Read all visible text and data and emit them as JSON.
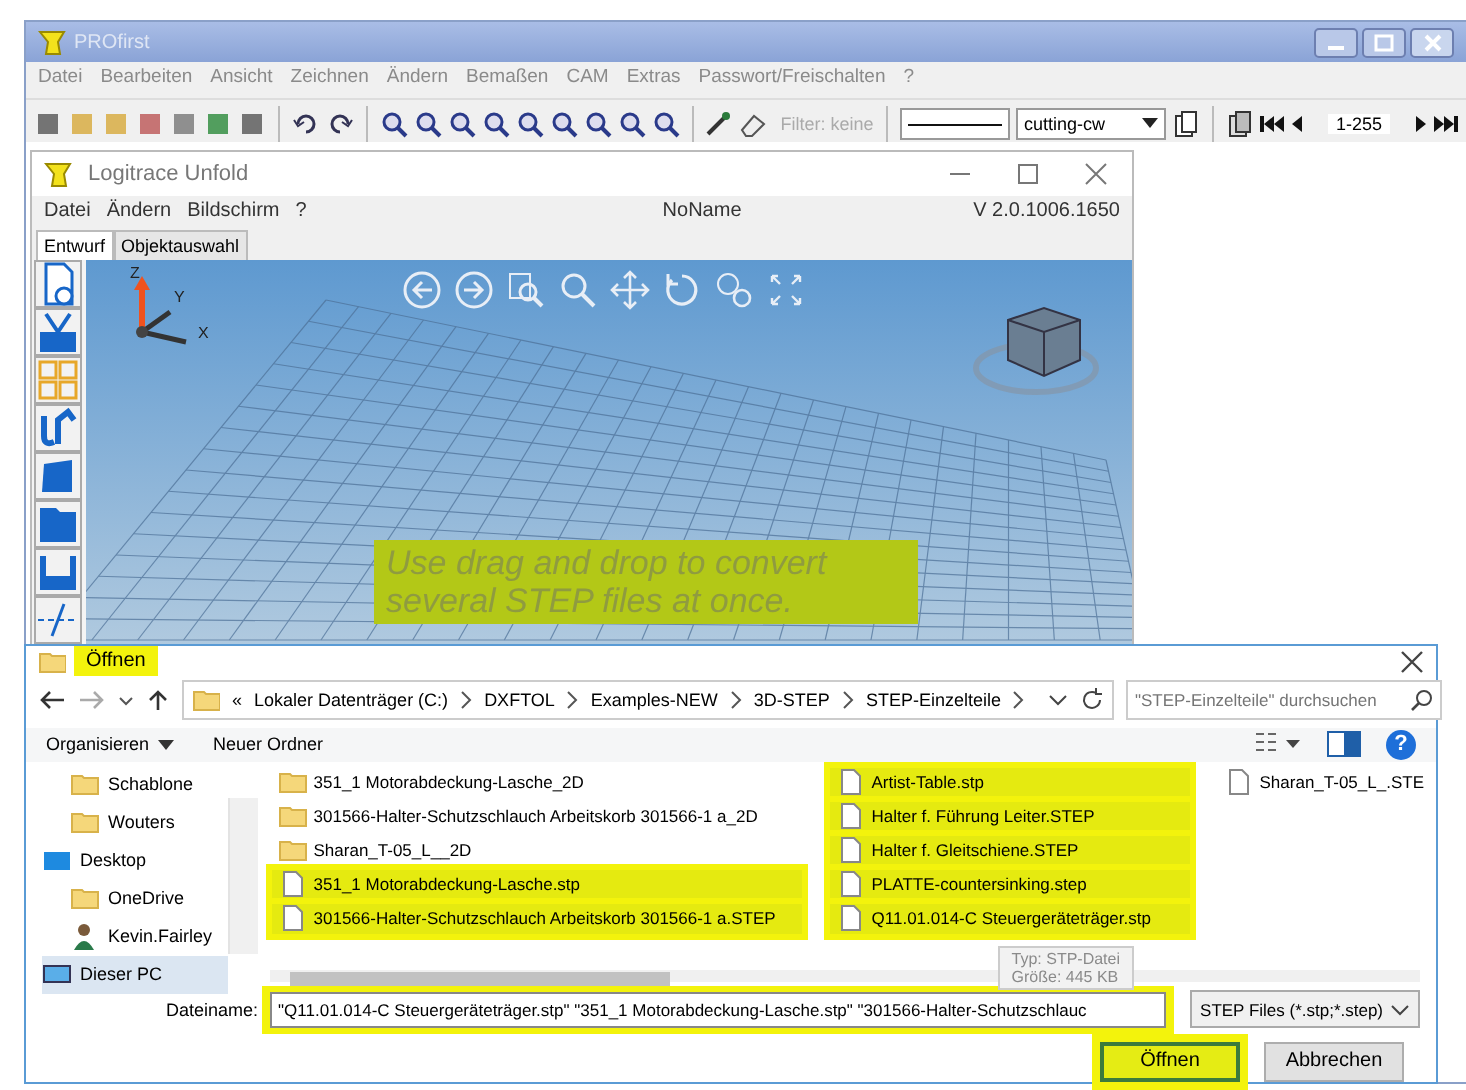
{
  "main_window": {
    "title": "PROfirst",
    "menu": [
      "Datei",
      "Bearbeiten",
      "Ansicht",
      "Zeichnen",
      "Ändern",
      "Bemaßen",
      "CAM",
      "Extras",
      "Passwort/Freischalten",
      "?"
    ],
    "filter_label": "Filter: keine",
    "line_style": "cutting-cw",
    "page_range": "1-255"
  },
  "unfold_window": {
    "title": "Logitrace Unfold",
    "menu": [
      "Datei",
      "Ändern",
      "Bildschirm",
      "?"
    ],
    "document": "NoName",
    "version": "V 2.0.1006.1650",
    "tabs": [
      {
        "label": "Entwurf",
        "selected": true
      },
      {
        "label": "Objektauswahl",
        "selected": false
      }
    ],
    "axis_labels": [
      "Z",
      "Y",
      "X"
    ],
    "hint": "Use drag and drop to convert several STEP files at once."
  },
  "open_dialog": {
    "title": "Öffnen",
    "breadcrumb": [
      "«",
      "Lokaler Datenträger (C:)",
      "DXFTOL",
      "Examples-NEW",
      "3D-STEP",
      "STEP-Einzelteile"
    ],
    "search": {
      "placeholder": "\"STEP-Einzelteile\" durchsuchen"
    },
    "commands": [
      "Organisieren",
      "Neuer Ordner"
    ],
    "nav_items": [
      {
        "label": "Schablone",
        "kind": "folder"
      },
      {
        "label": "Wouters",
        "kind": "folder"
      },
      {
        "label": "Desktop",
        "kind": "desktop"
      },
      {
        "label": "OneDrive",
        "kind": "folder"
      },
      {
        "label": "Kevin.Fairley",
        "kind": "user"
      },
      {
        "label": "Dieser PC",
        "kind": "pc"
      }
    ],
    "file_columns": [
      [
        {
          "name": "351_1  Motorabdeckung-Lasche_2D",
          "kind": "folder",
          "selected": false
        },
        {
          "name": "301566-Halter-Schutzschlauch Arbeitskorb  301566-1 a_2D",
          "kind": "folder",
          "selected": false
        },
        {
          "name": "Sharan_T-05_L__2D",
          "kind": "folder",
          "selected": false
        },
        {
          "name": "351_1  Motorabdeckung-Lasche.stp",
          "kind": "file",
          "selected": true
        },
        {
          "name": "301566-Halter-Schutzschlauch Arbeitskorb  301566-1 a.STEP",
          "kind": "file",
          "selected": true
        }
      ],
      [
        {
          "name": "Artist-Table.stp",
          "kind": "file",
          "selected": true
        },
        {
          "name": "Halter f. Führung Leiter.STEP",
          "kind": "file",
          "selected": true
        },
        {
          "name": "Halter f. Gleitschiene.STEP",
          "kind": "file",
          "selected": true
        },
        {
          "name": "PLATTE-countersinking.step",
          "kind": "file",
          "selected": true
        },
        {
          "name": "Q11.01.014-C Steuergeräteträger.stp",
          "kind": "file",
          "selected": true
        }
      ],
      [
        {
          "name": "Sharan_T-05_L_.STE",
          "kind": "file",
          "selected": false
        }
      ]
    ],
    "tooltip": [
      "Typ: STP-Datei",
      "Größe: 445 KB"
    ],
    "filename_label": "Dateiname:",
    "filename": "\"Q11.01.014-C Steuergeräteträger.stp\" \"351_1  Motorabdeckung-Lasche.stp\" \"301566-Halter-Schutzschlauc",
    "file_type": "STEP Files (*.stp;*.step)",
    "buttons": [
      "Öffnen",
      "Abbrechen"
    ],
    "help": "?"
  }
}
